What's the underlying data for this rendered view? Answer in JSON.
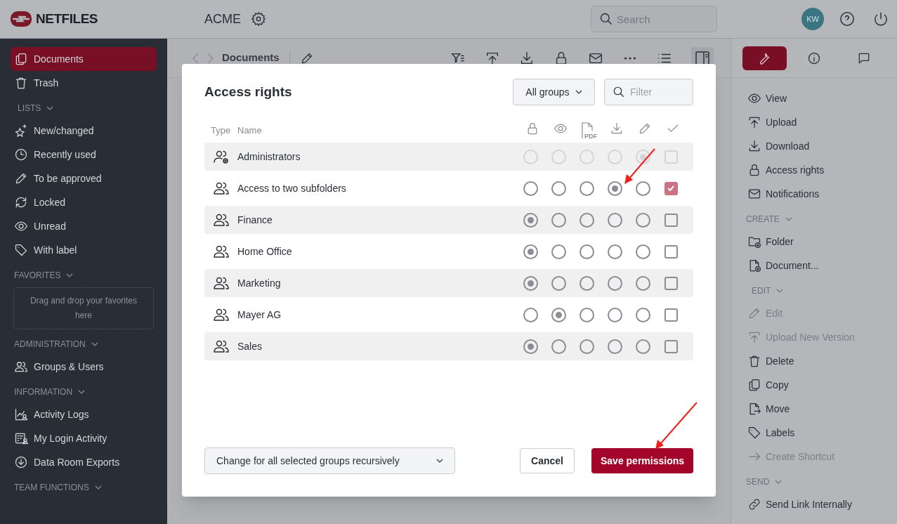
{
  "header": {
    "logo": "NETFILES",
    "workspace": "ACME",
    "search_placeholder": "Search",
    "avatar": "KW"
  },
  "sidebar": {
    "sections": [
      {
        "items": [
          {
            "label": "Documents",
            "kind": "documents",
            "selected": true
          },
          {
            "label": "Trash",
            "kind": "trash",
            "selected": false
          }
        ]
      },
      {
        "title": "LISTS",
        "items": [
          {
            "label": "New/changed",
            "kind": "sparkle",
            "selected": false
          },
          {
            "label": "Recently used",
            "kind": "clock",
            "selected": false
          },
          {
            "label": "To be approved",
            "kind": "pencil",
            "selected": false
          },
          {
            "label": "Locked",
            "kind": "refresh",
            "selected": false
          },
          {
            "label": "Unread",
            "kind": "eye",
            "selected": false
          },
          {
            "label": "With label",
            "kind": "tag",
            "selected": false
          }
        ]
      },
      {
        "title": "FAVORITES",
        "dropzone": "Drag and drop your favorites here"
      },
      {
        "title": "ADMINISTRATION",
        "items": [
          {
            "label": "Groups & Users",
            "kind": "users",
            "selected": false
          }
        ]
      },
      {
        "title": "INFORMATION",
        "items": [
          {
            "label": "Activity Logs",
            "kind": "chart",
            "selected": false
          },
          {
            "label": "My Login Activity",
            "kind": "list",
            "selected": false
          },
          {
            "label": "Data Room Exports",
            "kind": "download-circle",
            "selected": false
          }
        ]
      },
      {
        "title": "TEAM FUNCTIONS"
      }
    ]
  },
  "toolbar": {
    "breadcrumb": "Documents"
  },
  "right_panel": {
    "tabs": [
      {
        "kind": "wrench",
        "selected": true
      },
      {
        "kind": "info",
        "selected": false
      },
      {
        "kind": "chat",
        "selected": false
      }
    ],
    "sections": [
      {
        "items": [
          {
            "label": "View",
            "kind": "eye",
            "disabled": false
          },
          {
            "label": "Upload",
            "kind": "upload",
            "disabled": false
          },
          {
            "label": "Download",
            "kind": "download",
            "disabled": false
          },
          {
            "label": "Access rights",
            "kind": "lock",
            "disabled": false
          },
          {
            "label": "Notifications",
            "kind": "mail",
            "disabled": false
          }
        ]
      },
      {
        "title": "CREATE",
        "items": [
          {
            "label": "Folder",
            "kind": "folder-plus",
            "disabled": false
          },
          {
            "label": "Document...",
            "kind": "doc-plus",
            "disabled": false
          }
        ]
      },
      {
        "title": "EDIT",
        "items": [
          {
            "label": "Edit",
            "kind": "pencil",
            "disabled": true
          },
          {
            "label": "Upload New Version",
            "kind": "upload",
            "disabled": true
          },
          {
            "label": "Delete",
            "kind": "trash",
            "disabled": false
          },
          {
            "label": "Copy",
            "kind": "documents",
            "disabled": false
          },
          {
            "label": "Move",
            "kind": "move",
            "disabled": false
          },
          {
            "label": "Labels",
            "kind": "tag",
            "disabled": false
          },
          {
            "label": "Create Shortcut",
            "kind": "arrow",
            "disabled": true
          }
        ]
      },
      {
        "title": "SEND",
        "items": [
          {
            "label": "Send Link Internally",
            "kind": "link",
            "disabled": false
          }
        ]
      }
    ]
  },
  "dialog": {
    "title": "Access rights",
    "group_filter": "All groups",
    "filter_placeholder": "Filter",
    "columns": {
      "type": "Type",
      "name": "Name",
      "rights": [
        {
          "kind": "lock"
        },
        {
          "kind": "eye"
        },
        {
          "kind": "pdf",
          "badge": "PDF"
        },
        {
          "kind": "download"
        },
        {
          "kind": "pencil"
        },
        {
          "kind": "check"
        }
      ]
    },
    "rows": [
      {
        "name": "Administrators",
        "kind": "admin-group",
        "disabled": true,
        "rights": [
          {
            "selected": false
          },
          {
            "selected": false
          },
          {
            "selected": false
          },
          {
            "selected": false
          },
          {
            "selected": true
          }
        ],
        "recursive": false
      },
      {
        "name": "Access to two subfolders",
        "kind": "group",
        "disabled": false,
        "rights": [
          {
            "selected": false
          },
          {
            "selected": false
          },
          {
            "selected": false
          },
          {
            "selected": true
          },
          {
            "selected": false
          }
        ],
        "recursive": true
      },
      {
        "name": "Finance",
        "kind": "group",
        "disabled": false,
        "rights": [
          {
            "selected": true
          },
          {
            "selected": false
          },
          {
            "selected": false
          },
          {
            "selected": false
          },
          {
            "selected": false
          }
        ],
        "recursive": false
      },
      {
        "name": "Home Office",
        "kind": "group",
        "disabled": false,
        "rights": [
          {
            "selected": true
          },
          {
            "selected": false
          },
          {
            "selected": false
          },
          {
            "selected": false
          },
          {
            "selected": false
          }
        ],
        "recursive": false
      },
      {
        "name": "Marketing",
        "kind": "group",
        "disabled": false,
        "rights": [
          {
            "selected": true
          },
          {
            "selected": false
          },
          {
            "selected": false
          },
          {
            "selected": false
          },
          {
            "selected": false
          }
        ],
        "recursive": false
      },
      {
        "name": "Mayer AG",
        "kind": "group",
        "disabled": false,
        "rights": [
          {
            "selected": false
          },
          {
            "selected": true
          },
          {
            "selected": false
          },
          {
            "selected": false
          },
          {
            "selected": false
          }
        ],
        "recursive": false
      },
      {
        "name": "Sales",
        "kind": "group",
        "disabled": false,
        "rights": [
          {
            "selected": true
          },
          {
            "selected": false
          },
          {
            "selected": false
          },
          {
            "selected": false
          },
          {
            "selected": false
          }
        ],
        "recursive": false
      }
    ],
    "apply_mode": "Change for all selected groups recursively",
    "cancel": "Cancel",
    "save": "Save permissions"
  }
}
